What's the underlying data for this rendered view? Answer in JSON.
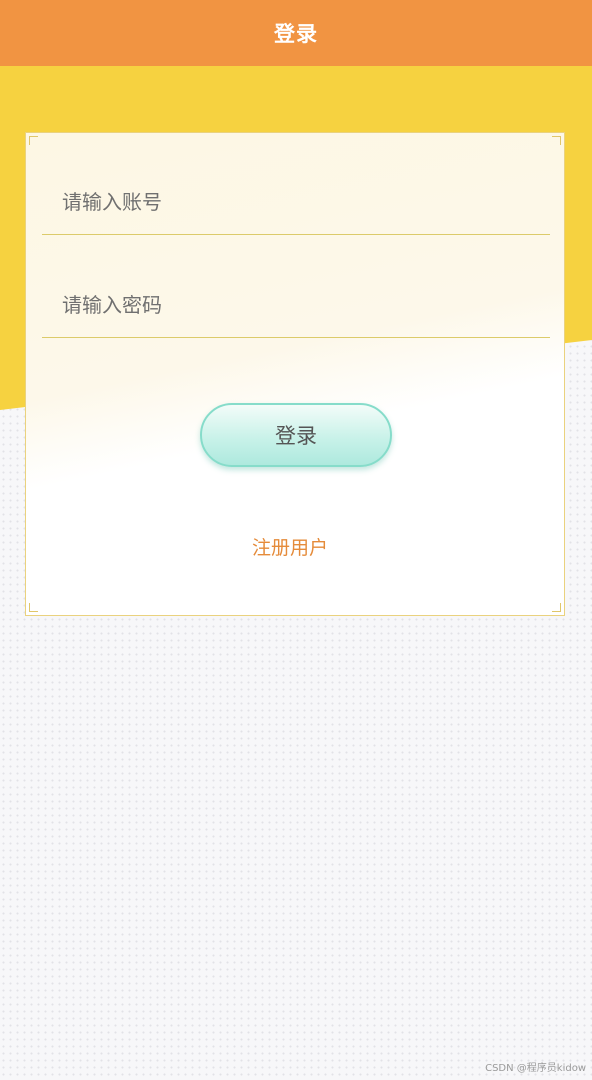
{
  "header": {
    "title": "登录"
  },
  "form": {
    "account_placeholder": "请输入账号",
    "password_placeholder": "请输入密码",
    "login_label": "登录",
    "register_label": "注册用户"
  },
  "watermark": "CSDN @程序员kidow",
  "colors": {
    "header_bg": "#f19442",
    "yellow_band": "#f6d240",
    "button_border": "#86dcca",
    "link": "#e58b3a"
  }
}
